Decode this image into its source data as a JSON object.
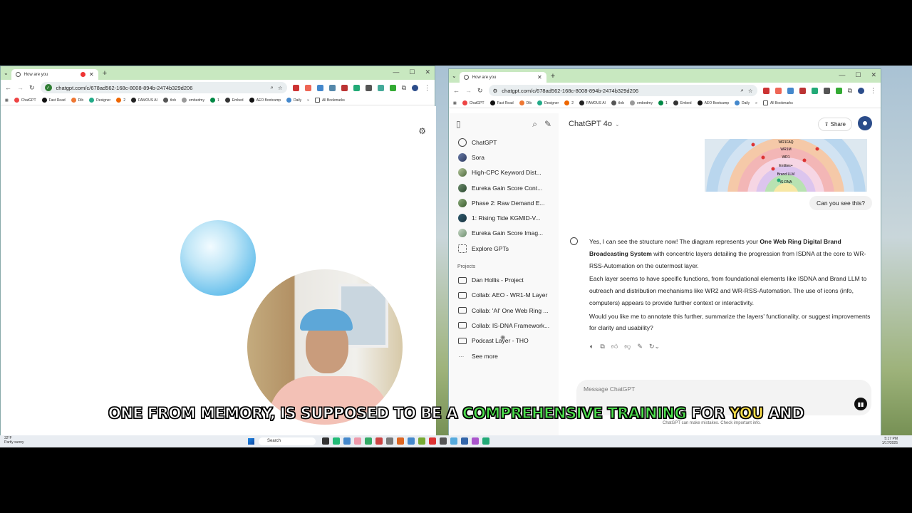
{
  "left_window": {
    "tab_title": "How are you",
    "url": "chatgpt.com/c/678ad562-168c-8008-894b-2474b329d206"
  },
  "right_window": {
    "tab_title": "How are you",
    "url": "chatgpt.com/c/678ad562-168c-8008-894b-2474b329d206"
  },
  "bookmarks": [
    "ChatGPT",
    "Fast Read",
    "Dib",
    "Designer",
    "2",
    "FAMOUS AI",
    "tlob",
    "embedmy",
    "1",
    "Embed",
    "AEO Bootcamp",
    "Daily",
    "All Bookmarks"
  ],
  "sidebar": {
    "items": [
      {
        "label": "ChatGPT",
        "icon": "chatgpt-icon"
      },
      {
        "label": "Sora",
        "icon": "sora-icon"
      },
      {
        "label": "High-CPC Keyword Dist...",
        "icon": "gpt-avatar-icon"
      },
      {
        "label": "Eureka Gain Score Cont...",
        "icon": "gpt-avatar-icon"
      },
      {
        "label": "Phase 2: Raw Demand E...",
        "icon": "gpt-avatar-icon"
      },
      {
        "label": "1: Rising Tide KGMID-V...",
        "icon": "gpt-avatar-icon"
      },
      {
        "label": "Eureka Gain Score Imag...",
        "icon": "gpt-avatar-icon"
      },
      {
        "label": "Explore GPTs",
        "icon": "grid-icon"
      }
    ],
    "projects_heading": "Projects",
    "projects": [
      "Dan Hollis - Project",
      "Collab: AEO - WR1-M Layer",
      "Collab: 'AI' One Web Ring ...",
      "Collab: IS-DNA Framework...",
      "Podcast Layer - THO"
    ],
    "see_more": "See more"
  },
  "chat": {
    "model": "ChatGPT 4o",
    "share_label": "Share",
    "user_message": "Can you see this?",
    "answer": {
      "p1_a": "Yes, I can see the structure now! The diagram represents your ",
      "p1_bold": "One Web Ring Digital Brand Broadcasting System",
      "p1_b": " with concentric layers detailing the progression from ISDNA at the core to WR-RSS-Automation on the outermost layer.",
      "p2": "Each layer seems to have specific functions, from foundational elements like ISDNA and Brand LLM to outreach and distribution mechanisms like WR2 and WR-RSS-Automation. The use of icons (info, computers) appears to provide further context or interactivity.",
      "p3": "Would you like me to annotate this further, summarize the layers' functionality, or suggest improvements for clarity and usability?"
    },
    "diagram_labels": [
      "WR1FAQ",
      "WR1M",
      "WR1",
      "Entities+",
      "Brand LLM",
      "IS-DNA"
    ],
    "composer_placeholder": "Message ChatGPT",
    "disclaimer": "ChatGPT can make mistakes. Check important info."
  },
  "taskbar": {
    "weather_temp": "32°F",
    "weather_desc": "Partly sunny",
    "search_label": "Search",
    "time": "5:17 PM",
    "date": "1/17/2025"
  },
  "caption": {
    "part1": "ONE FROM MEMORY, IS SUPPOSED TO BE A ",
    "part2": "COMPREHENSIVE TRAINING",
    "part3": " FOR ",
    "part4": "YOU",
    "part5": " AND"
  }
}
